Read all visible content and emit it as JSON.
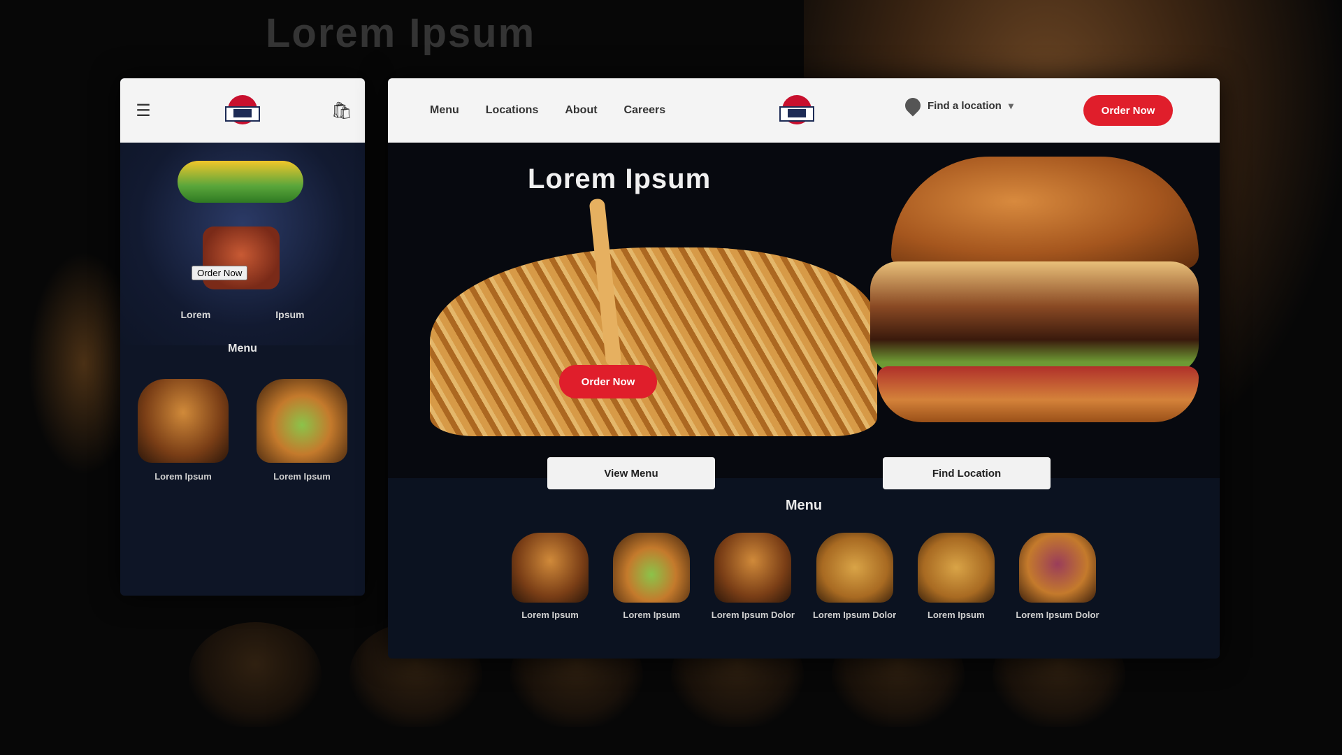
{
  "background": {
    "title": "Lorem Ipsum"
  },
  "mobile": {
    "header": {
      "menu_icon": "hamburger-menu-icon",
      "cart_icon": "shopping-bag-icon",
      "logo": "brand-logo"
    },
    "hero": {
      "cta_label": "Order Now"
    },
    "links": [
      "Lorem",
      "Ipsum"
    ],
    "section_title": "Menu",
    "products": [
      {
        "name": "Lorem Ipsum",
        "variant": "classic"
      },
      {
        "name": "Lorem Ipsum",
        "variant": "green"
      }
    ]
  },
  "desktop": {
    "header": {
      "nav": [
        "Menu",
        "Locations",
        "About",
        "Careers"
      ],
      "logo": "brand-logo",
      "location_label": "Find a location",
      "location_icon": "map-pin-icon",
      "chevron_icon": "chevron-down-icon",
      "cta_label": "Order Now"
    },
    "hero": {
      "title": "Lorem Ipsum",
      "cta_label": "Order Now"
    },
    "buttons": [
      "View Menu",
      "Find Location"
    ],
    "section_title": "Menu",
    "products": [
      {
        "name": "Lorem Ipsum",
        "variant": "classic"
      },
      {
        "name": "Lorem Ipsum",
        "variant": "green"
      },
      {
        "name": "Lorem Ipsum Dolor",
        "variant": "classic"
      },
      {
        "name": "Lorem Ipsum Dolor",
        "variant": "crispy"
      },
      {
        "name": "Lorem Ipsum",
        "variant": "crispy"
      },
      {
        "name": "Lorem Ipsum Dolor",
        "variant": "purple"
      }
    ]
  },
  "colors": {
    "accent": "#e01e2b",
    "header_bg": "#f4f4f4",
    "panel_bg": "#0e1526",
    "page_bg": "#070707"
  }
}
